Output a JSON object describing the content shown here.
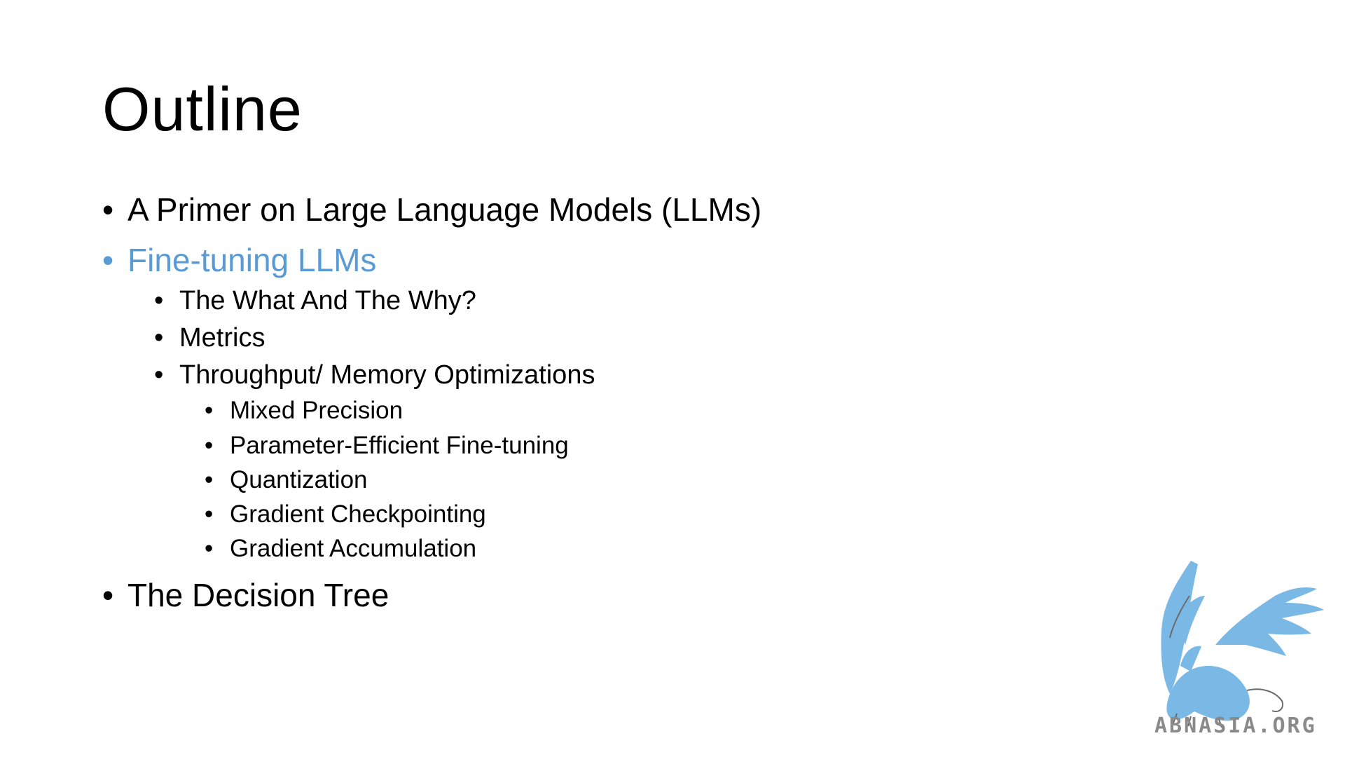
{
  "slide": {
    "title": "Outline",
    "accent_color": "#5b9bd5",
    "bullets": [
      {
        "text": "A Primer on Large Language Models (LLMs)",
        "level": 1,
        "highlighted": false
      },
      {
        "text": "Fine-tuning LLMs",
        "level": 1,
        "highlighted": true
      },
      {
        "text": "The What And The Why?",
        "level": 2,
        "highlighted": false
      },
      {
        "text": "Metrics",
        "level": 2,
        "highlighted": false
      },
      {
        "text": "Throughput/ Memory Optimizations",
        "level": 2,
        "highlighted": false
      },
      {
        "text": "Mixed Precision",
        "level": 3,
        "highlighted": false
      },
      {
        "text": "Parameter-Efficient Fine-tuning",
        "level": 3,
        "highlighted": false
      },
      {
        "text": "Quantization",
        "level": 3,
        "highlighted": false
      },
      {
        "text": "Gradient Checkpointing",
        "level": 3,
        "highlighted": false
      },
      {
        "text": "Gradient Accumulation",
        "level": 3,
        "highlighted": false
      },
      {
        "text": "The Decision Tree",
        "level": 1,
        "highlighted": false
      }
    ],
    "bullet_glyph": "•"
  },
  "watermark": {
    "icon": "griffin-logo-icon",
    "text": "ABNASIA.ORG",
    "color": "#7ab8e6"
  }
}
